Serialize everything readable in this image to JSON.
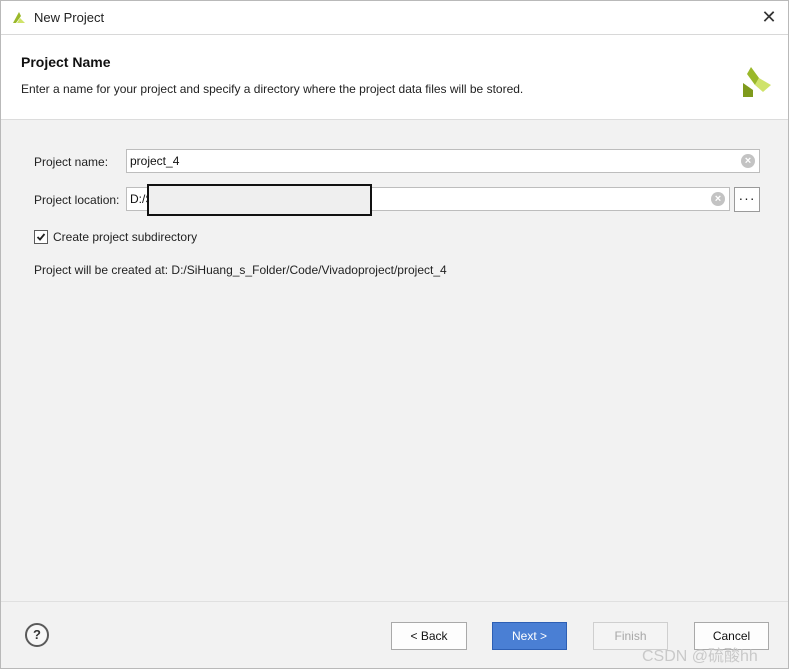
{
  "window": {
    "title": "New Project",
    "close_symbol": "✕"
  },
  "header": {
    "title": "Project Name",
    "description": "Enter a name for your project and specify a directory where the project data files will be stored."
  },
  "form": {
    "project_name_label": "Project name:",
    "project_name_value": "project_4",
    "project_location_label": "Project location:",
    "project_location_value": "D:/S",
    "browse_label": "···",
    "clear_symbol": "×",
    "create_subdirectory_label": "Create project subdirectory",
    "create_subdirectory_checked": true,
    "created_at_text": "Project will be created at: D:/SiHuang_s_Folder/Code/Vivadoproject/project_4"
  },
  "footer": {
    "help_label": "?",
    "back_label": "< Back",
    "next_label": "Next >",
    "finish_label": "Finish",
    "cancel_label": "Cancel"
  },
  "watermark": "CSDN @硫酸hh",
  "colors": {
    "accent": "#4a7fd4",
    "logo_green": "#9ab82a",
    "logo_light": "#cfe36a"
  }
}
